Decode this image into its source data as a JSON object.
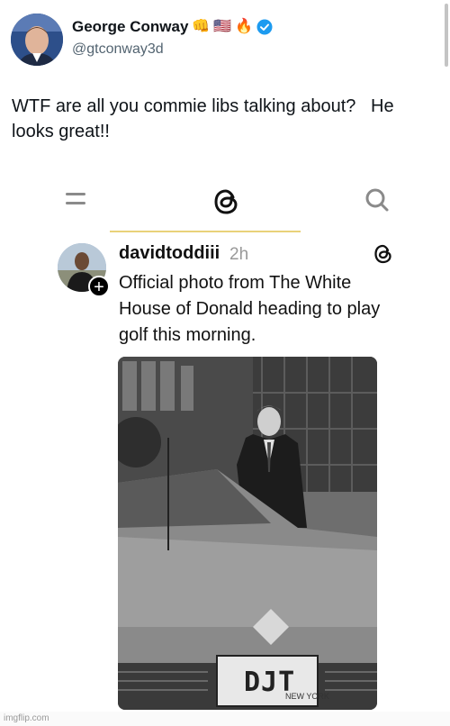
{
  "tweet": {
    "display_name": "George Conway",
    "emojis": [
      "👊",
      "🇺🇸",
      "🔥"
    ],
    "handle": "@gtconway3d",
    "text": "WTF are all you commie libs talking about?   He looks great!!",
    "verified_icon": "verified-badge-icon"
  },
  "threads_nav": {
    "left_icon": "menu-icon",
    "center_icon": "threads-logo-icon",
    "right_icon": "search-icon"
  },
  "embedded_post": {
    "username": "davidtoddiii",
    "time": "2h",
    "text": "Official photo from The White House of Donald heading to play golf this morning.",
    "plate_text": "DJT",
    "plate_state": "NEW YORK"
  },
  "watermark": "imgflip.com",
  "colors": {
    "verified_blue": "#1d9bf0",
    "handle_gray": "#536471",
    "underline_yellow": "#e9d27a"
  }
}
